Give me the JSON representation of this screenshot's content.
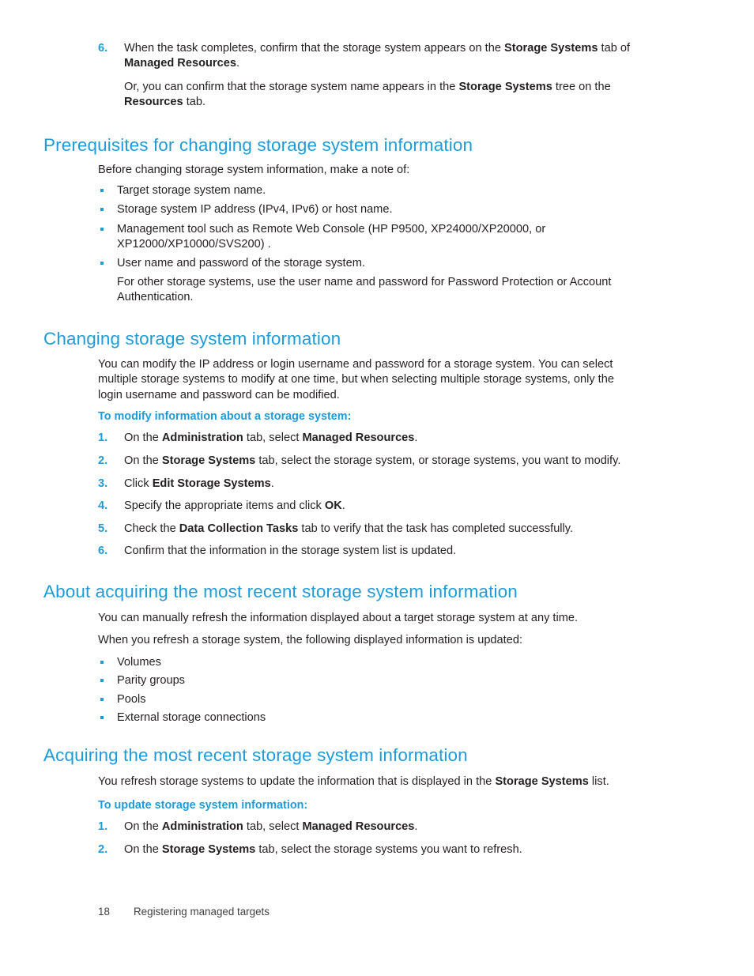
{
  "document": {
    "accent_color": "#1e9cd7",
    "text_color": "#231f20",
    "page_number": "18",
    "footer_title": "Registering managed targets"
  },
  "top_step": {
    "number": "6.",
    "text_part1": "When the task completes, confirm that the storage system appears on the ",
    "bold1": "Storage Systems",
    "text_part2": " tab of ",
    "bold2": "Managed Resources",
    "text_part3": "."
  },
  "top_note": {
    "text_part1": "Or, you can confirm that the storage system name appears in the ",
    "bold1": "Storage Systems",
    "text_part2": " tree on the ",
    "bold2": "Resources",
    "text_part3": " tab."
  },
  "section_prereq": {
    "heading": "Prerequisites for changing storage system information",
    "intro": "Before changing storage system information, make a note of:",
    "bullets": [
      "Target storage system name.",
      "Storage system IP address (IPv4, IPv6) or host name.",
      "Management tool such as Remote Web Console (HP P9500, XP24000/XP20000, or XP12000/XP10000/SVS200) .",
      "User name and password of the storage system."
    ],
    "bullet_note": "For other storage systems, use the user name and password for Password Protection or Account Authentication."
  },
  "section_changing": {
    "heading": "Changing storage system information",
    "intro": "You can modify the IP address or login username and password for a storage system. You can select multiple storage systems to modify at one time, but when selecting multiple storage systems, only the login username and password can be modified.",
    "subhead": "To modify information about a storage system:",
    "steps": [
      {
        "number": "1.",
        "pre": "On the ",
        "bold1": "Administration",
        "mid": " tab, select ",
        "bold2": "Managed Resources",
        "post": "."
      },
      {
        "number": "2.",
        "pre": "On the ",
        "bold1": "Storage Systems",
        "mid": " tab, select the storage system, or storage systems, you want to modify.",
        "bold2": "",
        "post": ""
      },
      {
        "number": "3.",
        "pre": "Click ",
        "bold1": "Edit Storage Systems",
        "mid": ".",
        "bold2": "",
        "post": ""
      },
      {
        "number": "4.",
        "pre": "Specify the appropriate items and click ",
        "bold1": "OK",
        "mid": ".",
        "bold2": "",
        "post": ""
      },
      {
        "number": "5.",
        "pre": "Check the ",
        "bold1": "Data Collection Tasks",
        "mid": " tab to verify that the task has completed successfully.",
        "bold2": "",
        "post": ""
      },
      {
        "number": "6.",
        "pre": "Confirm that the information in the storage system list is updated.",
        "bold1": "",
        "mid": "",
        "bold2": "",
        "post": ""
      }
    ]
  },
  "section_about": {
    "heading": "About acquiring the most recent storage system information",
    "para1": "You can manually refresh the information displayed about a target storage system at any time.",
    "para2": "When you refresh a storage system, the following displayed information is updated:",
    "bullets": [
      "Volumes",
      "Parity groups",
      "Pools",
      "External storage connections"
    ]
  },
  "section_acquiring": {
    "heading": "Acquiring the most recent storage system information",
    "intro_pre": "You refresh storage systems to update the information that is displayed in the ",
    "intro_bold": "Storage Systems",
    "intro_post": " list.",
    "subhead": "To update storage system information:",
    "steps": [
      {
        "number": "1.",
        "pre": "On the ",
        "bold1": "Administration",
        "mid": " tab, select ",
        "bold2": "Managed Resources",
        "post": "."
      },
      {
        "number": "2.",
        "pre": "On the ",
        "bold1": "Storage Systems",
        "mid": " tab, select the storage systems you want to refresh.",
        "bold2": "",
        "post": ""
      }
    ]
  }
}
